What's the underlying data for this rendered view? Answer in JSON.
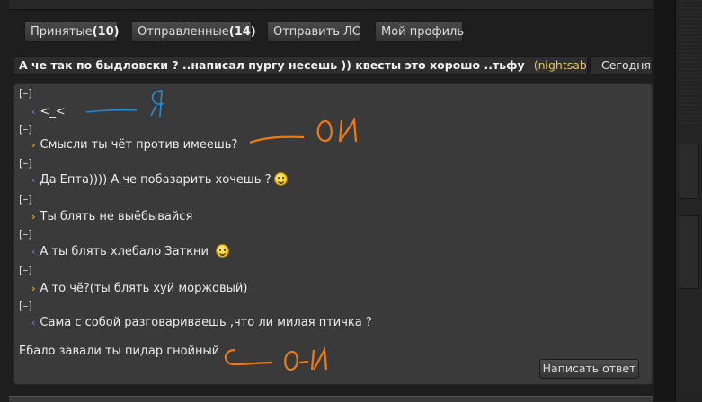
{
  "tabs": [
    {
      "label": "Принятые",
      "count": "(10)"
    },
    {
      "label": "Отправленные",
      "count": "(14)"
    },
    {
      "label": "Отправить ЛС",
      "count": ""
    },
    {
      "label": "Мой профиль",
      "count": ""
    }
  ],
  "message": {
    "subject": "А че так по быдловски ? ..написал пургу несешь )) квесты это хорошо ..тьфу",
    "author": "(nightsaber)",
    "date": "Сегодня"
  },
  "thread": [
    {
      "bracket": "[–]",
      "direction": "in",
      "text": "<_<",
      "smiley": false
    },
    {
      "bracket": "[–]",
      "direction": "out",
      "text": "Смысли ты чёт против имеешь?",
      "smiley": false
    },
    {
      "bracket": "[–]",
      "direction": "in",
      "text": "Да Епта)))) А че побазарить хочешь ?",
      "smiley": true
    },
    {
      "bracket": "[–]",
      "direction": "out",
      "text": "Ты блять не выёбывайся",
      "smiley": false
    },
    {
      "bracket": "[–]",
      "direction": "in",
      "text": "А ты блять хлебало Заткни",
      "smiley": true
    },
    {
      "bracket": "[–]",
      "direction": "out",
      "text": "А то чё?(ты блять хуй моржовый)",
      "smiley": false
    },
    {
      "bracket": "[–]",
      "direction": "in",
      "text": "Сама с собой разговариваешь ,что ли милая птичка ?",
      "smiley": false
    }
  ],
  "footer_text": "Ебало завали ты пидар гнойный",
  "reply_label": "Написать ответ",
  "colors": {
    "incoming_arrow": "#7a7aff",
    "outgoing_arrow": "#ff9a2a",
    "author": "#e8c26a",
    "annotation_blue": "#1e8fe0",
    "annotation_orange": "#f07a10"
  },
  "icons": {
    "incoming": "chevron-left-icon",
    "outgoing": "chevron-right-icon",
    "emoticon": "smiley-icon"
  }
}
